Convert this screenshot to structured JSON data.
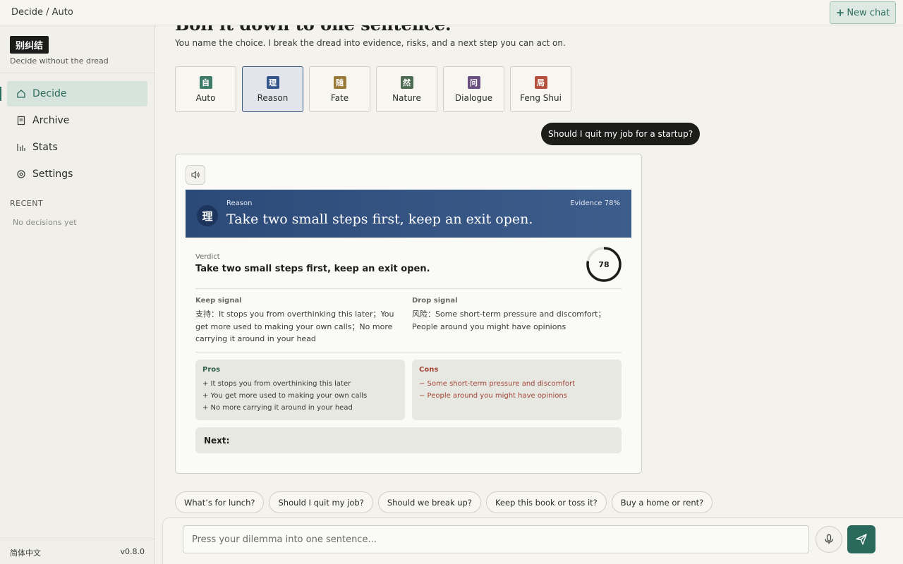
{
  "header": {
    "breadcrumb": "Decide / Auto",
    "new_chat_label": "New chat"
  },
  "sidebar": {
    "brand": "别纠结",
    "tagline": "Decide without the dread",
    "nav": [
      {
        "label": "Decide",
        "icon": "home-icon",
        "active": true
      },
      {
        "label": "Archive",
        "icon": "archive-icon",
        "active": false
      },
      {
        "label": "Stats",
        "icon": "stats-icon",
        "active": false
      },
      {
        "label": "Settings",
        "icon": "gear-icon",
        "active": false
      }
    ],
    "recent_label": "RECENT",
    "recent_empty": "No decisions yet",
    "language": "简体中文",
    "version": "v0.8.0"
  },
  "hero": {
    "title": "Boil it down to one sentence.",
    "subtitle": "You name the choice. I break the dread into evidence, risks, and a next step you can act on."
  },
  "modes": [
    {
      "glyph": "自",
      "label": "Auto",
      "color": "#3d7a68",
      "selected": false
    },
    {
      "glyph": "理",
      "label": "Reason",
      "color": "#35568a",
      "selected": true
    },
    {
      "glyph": "随",
      "label": "Fate",
      "color": "#9a7a3a",
      "selected": false
    },
    {
      "glyph": "然",
      "label": "Nature",
      "color": "#4d6a52",
      "selected": false
    },
    {
      "glyph": "问",
      "label": "Dialogue",
      "color": "#6a4f80",
      "selected": false
    },
    {
      "glyph": "局",
      "label": "Feng Shui",
      "color": "#b4513e",
      "selected": false
    }
  ],
  "conversation": {
    "user_message": "Should I quit my job for a startup?",
    "result": {
      "mode_glyph": "理",
      "mode_label": "Reason",
      "headline": "Take two small steps first, keep an exit open.",
      "evidence_label": "Evidence 78%",
      "evidence_score": 78,
      "verdict_label": "Verdict",
      "verdict": "Take two small steps first, keep an exit open.",
      "keep_label": "Keep signal",
      "keep_text": "支持：It stops you from overthinking this later；You get more used to making your own calls；No more carrying it around in your head",
      "drop_label": "Drop signal",
      "drop_text": "风险：Some short-term pressure and discomfort；People around you might have opinions",
      "pros_label": "Pros",
      "pros": [
        "+ It stops you from overthinking this later",
        "+ You get more used to making your own calls",
        "+ No more carrying it around in your head"
      ],
      "cons_label": "Cons",
      "cons": [
        "− Some short-term pressure and discomfort",
        "− People around you might have opinions"
      ],
      "next_label": "Next:"
    }
  },
  "suggestions": [
    "What’s for lunch?",
    "Should I quit my job?",
    "Should we break up?",
    "Keep this book or toss it?",
    "Buy a home or rent?"
  ],
  "composer": {
    "placeholder": "Press your dilemma into one sentence..."
  },
  "colors": {
    "accent": "#2a6a5c",
    "reason_blue": "#35568a",
    "pros_green": "#2f5f4a",
    "cons_red": "#a04434"
  }
}
